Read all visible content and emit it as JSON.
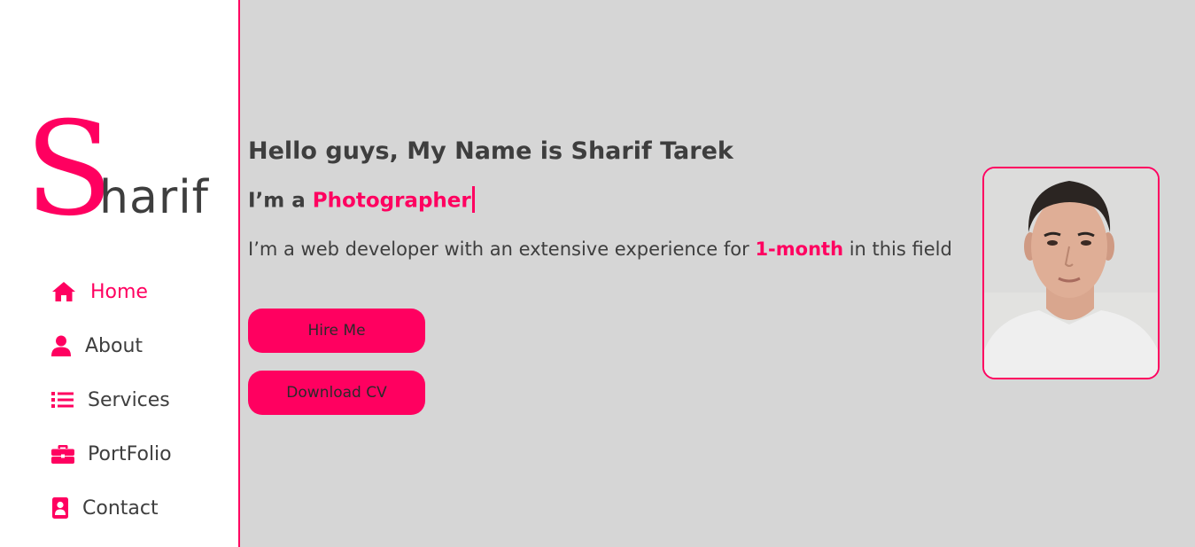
{
  "brand": {
    "initial": "S",
    "rest": "harif"
  },
  "nav": [
    {
      "label": "Home",
      "icon": "home-icon",
      "active": true
    },
    {
      "label": "About",
      "icon": "user-icon",
      "active": false
    },
    {
      "label": "Services",
      "icon": "list-icon",
      "active": false
    },
    {
      "label": "PortFolio",
      "icon": "briefcase-icon",
      "active": false
    },
    {
      "label": "Contact",
      "icon": "contact-icon",
      "active": false
    }
  ],
  "hero": {
    "greeting": "Hello guys, My Name is Sharif Tarek",
    "role_prefix": "I’m a ",
    "role_highlight": "Photographer",
    "desc_before": "I’m a web developer with an extensive experience for ",
    "desc_highlight": "1-month",
    "desc_after": " in this field",
    "hire_label": "Hire Me",
    "cv_label": "Download CV"
  },
  "colors": {
    "accent": "#ff0060",
    "text": "#3e3e3e",
    "background": "#d6d6d6"
  }
}
